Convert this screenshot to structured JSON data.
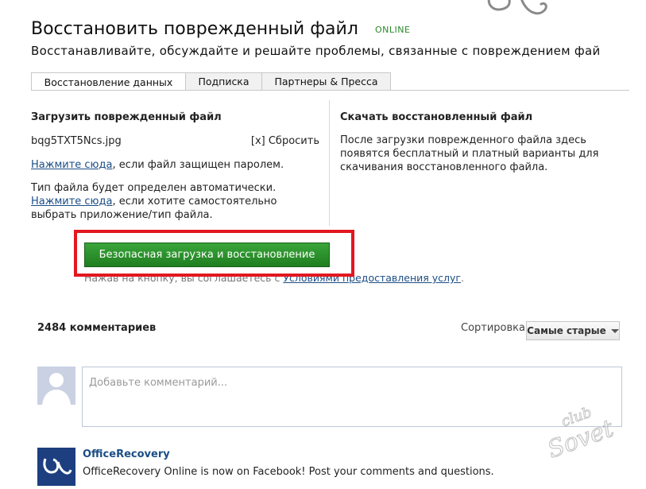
{
  "header": {
    "title": "Восстановить поврежденный файл",
    "badge": "ONLINE",
    "subtitle": "Восстанавливайте, обсуждайте и решайте проблемы, связанные с повреждением фай"
  },
  "tabs": [
    {
      "label": "Восстановление данных",
      "active": true
    },
    {
      "label": "Подписка",
      "active": false
    },
    {
      "label": "Партнеры & Пресса",
      "active": false
    }
  ],
  "upload": {
    "heading": "Загрузить поврежденный файл",
    "file_name": "bqg5TXT5Ncs.jpg",
    "reset_label": "[x] Сбросить",
    "password_link": "Нажмите сюда",
    "password_text": ", если файл защищен паролем.",
    "auto_text": "Тип файла будет определен автоматически.",
    "choose_link": "Нажмите сюда",
    "choose_text": ", если хотите самостоятельно выбрать приложение/тип файла.",
    "button_label": "Безопасная загрузка и восстановление",
    "terms_text": "Нажав на кнопку, вы соглашаетесь с ",
    "terms_link": "Условиями предоставления услуг",
    "terms_end": "."
  },
  "download": {
    "heading": "Скачать восстановленный файл",
    "text": "После загрузки поврежденного файла здесь появятся бесплатный и платный варианты для скачивания восстановленного файла."
  },
  "comments": {
    "count_label": "2484 комментариев",
    "sort_label": "Сортировка",
    "sort_value": "Самые старые",
    "input_placeholder": "Добавьте комментарий...",
    "post_author": "OfficeRecovery",
    "post_text": "OfficeRecovery Online is now on Facebook! Post your comments and questions."
  },
  "watermark": {
    "line1": "club",
    "line2": "Sovet"
  },
  "colors": {
    "accent_green": "#2a8a2a",
    "link": "#1b4d86",
    "highlight_frame": "#e3171f"
  },
  "icons": [
    "logo-swirl-icon",
    "avatar-silhouette-icon",
    "caret-down-icon",
    "officerecovery-logo-icon"
  ]
}
